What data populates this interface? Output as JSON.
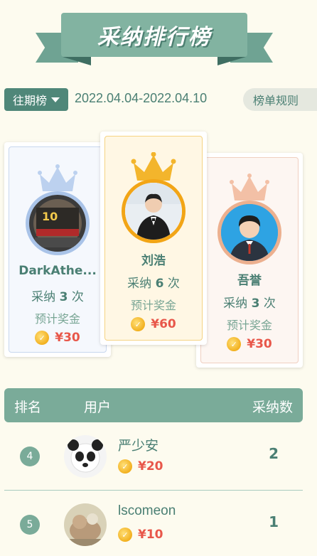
{
  "banner": {
    "title": "采纳排行榜"
  },
  "period": {
    "button_label": "往期榜",
    "date_range": "2022.04.04-2022.04.10",
    "rules_label": "榜单规则"
  },
  "podium": [
    {
      "rank": 1,
      "name": "刘浩",
      "count_prefix": "采纳",
      "count": "6",
      "count_suffix": "次",
      "bonus_label": "预计奖金",
      "prize": "¥60",
      "crown_color": "#f3b52c"
    },
    {
      "rank": 2,
      "name": "DarkAthe...",
      "count_prefix": "采纳",
      "count": "3",
      "count_suffix": "次",
      "bonus_label": "预计奖金",
      "prize": "¥30",
      "crown_color": "#bcd1ef"
    },
    {
      "rank": 3,
      "name": "吾誉",
      "count_prefix": "采纳",
      "count": "3",
      "count_suffix": "次",
      "bonus_label": "预计奖金",
      "prize": "¥30",
      "crown_color": "#f3c0a6"
    }
  ],
  "table": {
    "headers": {
      "rank": "排名",
      "user": "用户",
      "count": "采纳数"
    },
    "rows": [
      {
        "rank": "4",
        "name": "严少安",
        "prize": "¥20",
        "count": "2"
      },
      {
        "rank": "5",
        "name": "lscomeon",
        "prize": "¥10",
        "count": "1"
      }
    ]
  },
  "colors": {
    "accent": "#7aab99",
    "accent_dark": "#4f8779",
    "prize": "#e8574a",
    "background": "#fdfbef"
  }
}
